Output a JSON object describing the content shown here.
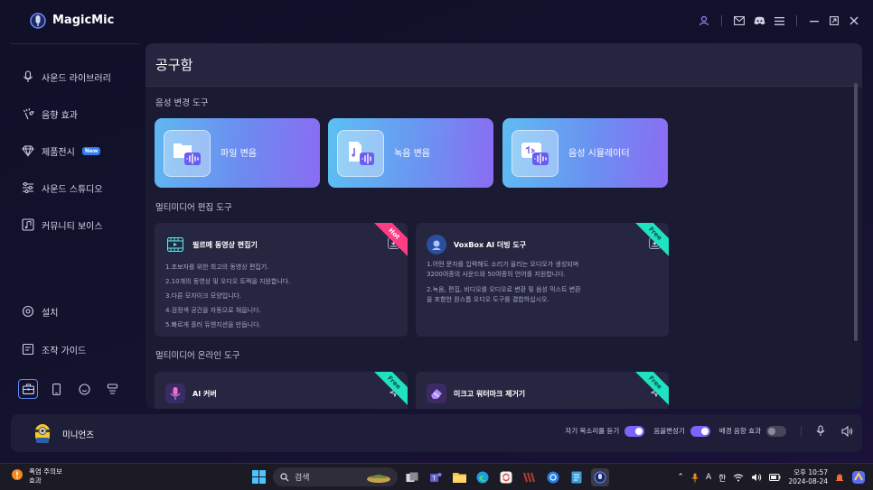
{
  "app": {
    "name": "MagicMic",
    "accent": "#7a66ff"
  },
  "titlebar": {
    "icons": [
      "user-icon",
      "mail-icon",
      "discord-icon",
      "menu-icon",
      "minimize-icon",
      "restore-icon",
      "close-icon"
    ]
  },
  "sidebar": {
    "items": [
      {
        "label": "사운드 라이브러리",
        "icon": "microphone-icon"
      },
      {
        "label": "음향 효과",
        "icon": "sparkle-icon"
      },
      {
        "label": "제품전시",
        "icon": "diamond-icon",
        "badge": "New"
      },
      {
        "label": "사운드 스튜디오",
        "icon": "sliders-icon"
      },
      {
        "label": "커뮤니티 보이스",
        "icon": "music-note-icon"
      },
      {
        "label": "설치",
        "icon": "gear-icon"
      },
      {
        "label": "조작 가이드",
        "icon": "book-icon"
      }
    ],
    "bottom_tabs": [
      "toolbox-icon",
      "phone-icon",
      "chat-icon",
      "game-icon"
    ]
  },
  "main": {
    "title": "공구함",
    "sections": {
      "voice_tools": "음성 변경 도구",
      "media_edit": "멀티미디어 편집 도구",
      "media_online": "멀티미디어 온라인 도구"
    },
    "voice_cards": [
      {
        "label": "파일 변음"
      },
      {
        "label": "녹음 변음"
      },
      {
        "label": "음성 시뮬레이터"
      }
    ],
    "edit_tools": [
      {
        "name": "필르메 동영상 편집기",
        "ribbon": "Hot",
        "desc": [
          "1.초보자를 위한 최고의 동영상 편집기.",
          "2.10개의 동영상 및 오디오 트랙을 지원합니다.",
          "3.다른 모자이크 모양입니다.",
          "4.검정색 공간을 자동으로 채웁니다.",
          "5.빠르게 흘러 듀엔지션을 만듭니다."
        ]
      },
      {
        "name": "VoxBox AI 더빙 도구",
        "ribbon": "Free",
        "desc": [
          "1.어떤 문자를 입력해도 소리가 울리는 오디오가 생성되며",
          "3200여종의 사운드와 50여종의 언어를 지원합니다.",
          "2.녹음, 편집, 비디오를 오디오로 변환 및 음성 믹스트 변환",
          "을 포함한 원스톱 오디오 도구를 결합하십시오."
        ]
      }
    ],
    "online_tools": [
      {
        "name": "AI 커버",
        "ribbon": "Free"
      },
      {
        "name": "미크고 워터마크 제거기",
        "ribbon": "Free"
      }
    ]
  },
  "player": {
    "voice_name": "미니언즈",
    "hear_self_label": "자기 목소리를 듣기",
    "hear_self_on": true,
    "voice_change_label": "음을변성기",
    "voice_change_on": true,
    "bg_effect_label": "배경 음향 효과",
    "bg_effect_on": false
  },
  "taskbar": {
    "weather_line1": "폭염 주의보",
    "weather_line2": "효과",
    "search_placeholder": "검색",
    "ime_a": "A",
    "ime_han": "한",
    "time": "오후 10:57",
    "date": "2024-08-24"
  }
}
